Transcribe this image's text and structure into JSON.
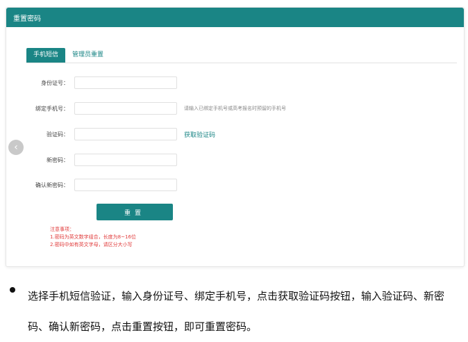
{
  "header": {
    "title": "重置密码"
  },
  "tabs": [
    {
      "label": "手机短信",
      "active": true
    },
    {
      "label": "管理员重置",
      "active": false
    }
  ],
  "form": {
    "id_label": "身份证号：",
    "phone_label": "绑定手机号：",
    "phone_hint": "请输入已绑定手机号或高考报名时预留的手机号",
    "code_label": "验证码：",
    "get_code": "获取验证码",
    "new_pwd_label": "新密码：",
    "confirm_label": "确认新密码：",
    "reset_button": "重置"
  },
  "notice": {
    "title": "注意事项：",
    "line1": "1.密码为英文数字组合，长度为8~16位",
    "line2": "2.密码中如有英文字母，请区分大小写"
  },
  "caption": "选择手机短信验证，输入身份证号、绑定手机号，点击获取验证码按钮，输入验证码、新密码、确认新密码，点击重置按钮，即可重置密码。",
  "colors": {
    "primary": "#1a8585",
    "notice": "#e03a3a"
  },
  "icons": {
    "nav_arrow": "chevron-left-icon"
  }
}
